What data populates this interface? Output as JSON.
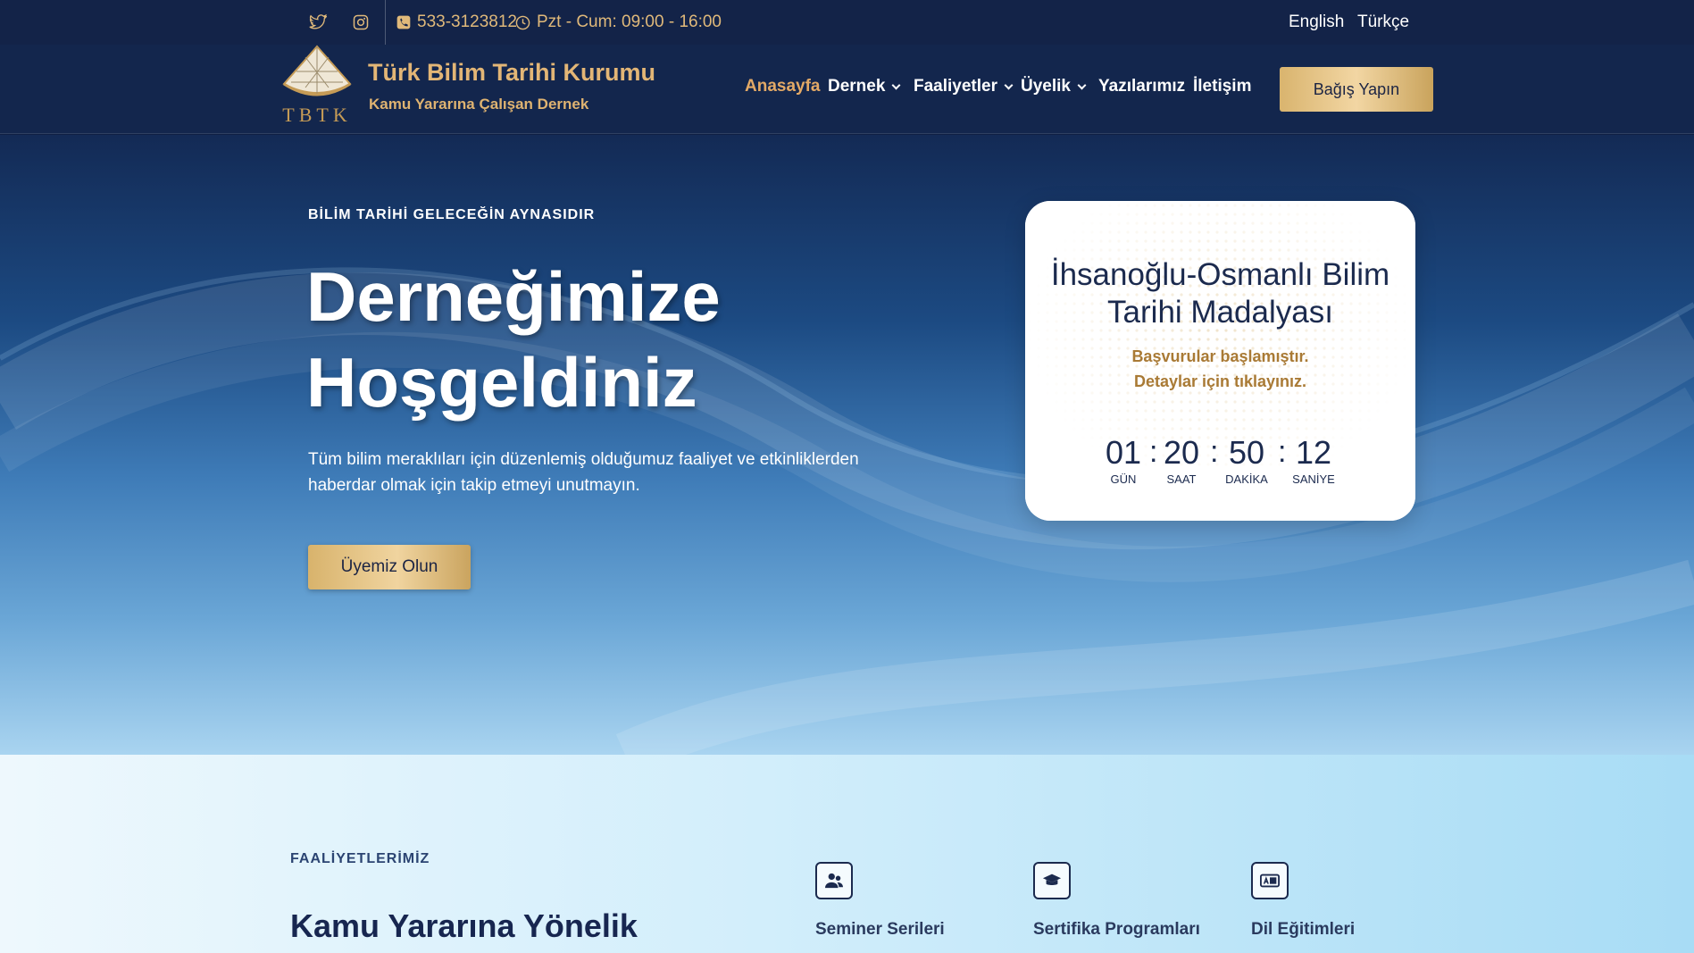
{
  "topbar": {
    "phone": "533-3123812",
    "hours": "Pzt - Cum: 09:00 - 16:00",
    "languages": [
      "English",
      "Türkçe"
    ],
    "social_icons": [
      "twitter-icon",
      "instagram-icon"
    ]
  },
  "brand": {
    "title": "Türk Bilim Tarihi Kurumu",
    "subtitle": "Kamu Yararına Çalışan Dernek",
    "logo_text": "TBTK"
  },
  "nav": {
    "items": [
      {
        "label": "Anasayfa",
        "active": true,
        "dropdown": false
      },
      {
        "label": "Dernek",
        "active": false,
        "dropdown": true
      },
      {
        "label": "Faaliyetler",
        "active": false,
        "dropdown": true
      },
      {
        "label": "Üyelik",
        "active": false,
        "dropdown": true
      },
      {
        "label": "Yazılarımız",
        "active": false,
        "dropdown": false
      },
      {
        "label": "İletişim",
        "active": false,
        "dropdown": false
      }
    ],
    "donate_label": "Bağış Yapın"
  },
  "hero": {
    "kicker": "BİLİM TARİHİ GELECEĞİN AYNASIDIR",
    "title": "Derneğimize Hoşgeldiniz",
    "description": "Tüm bilim meraklıları için düzenlemiş olduğumuz faaliyet ve etkinliklerden haberdar olmak için takip etmeyi unutmayın.",
    "cta_label": "Üyemiz Olun"
  },
  "award_card": {
    "title": "İhsanoğlu-Osmanlı Bilim Tarihi Madalyası",
    "subtitle_line1": "Başvurular başlamıştır.",
    "subtitle_line2": "Detaylar için tıklayınız.",
    "countdown": [
      {
        "value": "01",
        "label": "GÜN"
      },
      {
        "value": "20",
        "label": "SAAT"
      },
      {
        "value": "50",
        "label": "DAKİKA"
      },
      {
        "value": "12",
        "label": "SANİYE"
      }
    ]
  },
  "activities": {
    "kicker": "FAALİYETLERİMİZ",
    "title": "Kamu Yararına Yönelik",
    "features": [
      {
        "label": "Seminer Serileri",
        "icon": "users-icon"
      },
      {
        "label": "Sertifika Programları",
        "icon": "graduation-cap-icon"
      },
      {
        "label": "Dil Eğitimleri",
        "icon": "language-icon"
      }
    ]
  },
  "colors": {
    "gold": "#e3b676",
    "navy": "#132348",
    "accent_nav": "#e3a966"
  }
}
